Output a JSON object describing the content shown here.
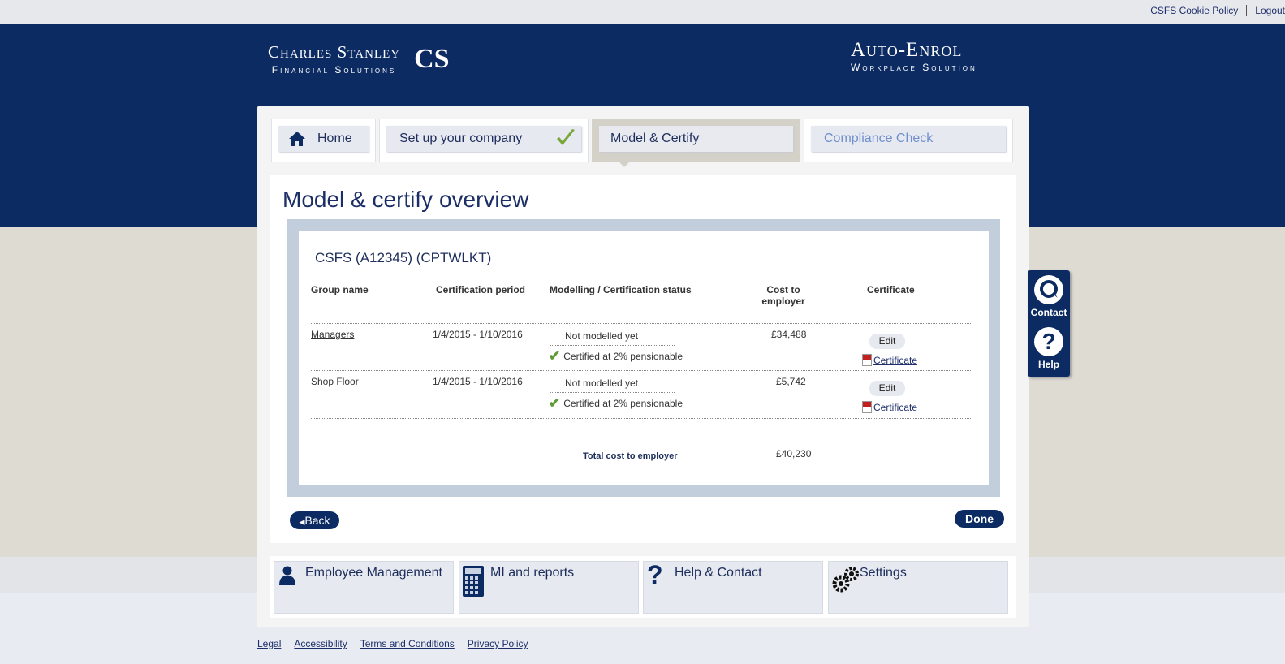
{
  "toplinks": {
    "cookie": "CSFS Cookie Policy",
    "logout": "Logout"
  },
  "brand": {
    "left_line1": "Charles Stanley",
    "left_line2": "Financial Solutions",
    "left_mono": "CS",
    "right_line1": "Auto-Enrol",
    "right_line2": "Workplace Solution"
  },
  "tabs": [
    {
      "label": "Home",
      "icon": "home-icon"
    },
    {
      "label": "Set up your company",
      "icon": "checkmark-icon"
    },
    {
      "label": "Model & Certify"
    },
    {
      "label": "Compliance Check"
    }
  ],
  "page_title": "Model & certify overview",
  "company": "CSFS (A12345) (CPTWLKT)",
  "table": {
    "headers": {
      "group": "Group name",
      "period": "Certification period",
      "status": "Modelling / Certification status",
      "cost_line1": "Cost to",
      "cost_line2": "employer",
      "certificate": "Certificate"
    },
    "rows": [
      {
        "group": "Managers",
        "period": "1/4/2015 - 1/10/2016",
        "status1": "Not modelled yet",
        "status2": "Certified at 2% pensionable",
        "cost": "£34,488",
        "edit": "Edit",
        "cert": "Certificate"
      },
      {
        "group": "Shop Floor",
        "period": "1/4/2015 - 1/10/2016",
        "status1": "Not modelled yet",
        "status2": "Certified at 2% pensionable",
        "cost": "£5,742",
        "edit": "Edit",
        "cert": "Certificate"
      }
    ],
    "total_label": "Total cost to employer",
    "total_value": "£40,230"
  },
  "buttons": {
    "back": "Back",
    "done": "Done"
  },
  "sidebar": {
    "contact": "Contact",
    "help": "Help"
  },
  "bottom_tabs": [
    {
      "label": "Employee Management",
      "icon": "user-icon"
    },
    {
      "label": "MI and reports",
      "icon": "calculator-icon"
    },
    {
      "label": "Help & Contact",
      "icon": "question-icon"
    },
    {
      "label": "Settings",
      "icon": "gears-icon"
    }
  ],
  "footer": [
    "Legal",
    "Accessibility",
    "Terms and Conditions",
    "Privacy Policy"
  ],
  "colors": {
    "navy": "#0c2b63",
    "beige": "#dedbd3",
    "check_green": "#5f9a32"
  }
}
